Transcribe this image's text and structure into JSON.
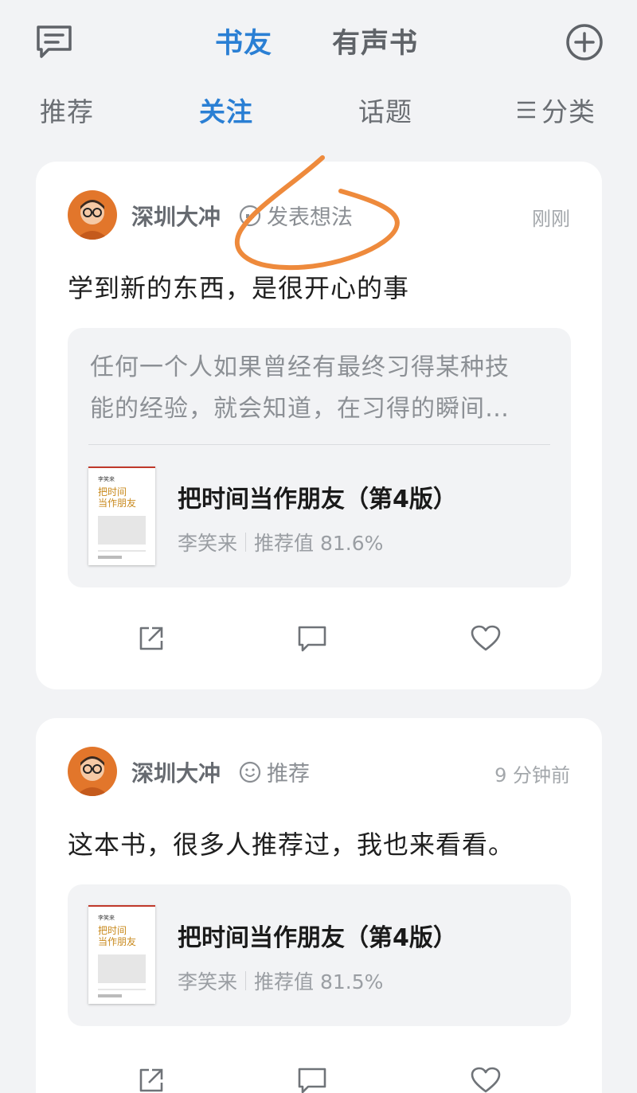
{
  "header": {
    "tabs": [
      {
        "label": "书友",
        "active": true
      },
      {
        "label": "有声书",
        "active": false
      }
    ],
    "icons": {
      "left": "message-icon",
      "right": "add-circle-icon"
    }
  },
  "subtabs": [
    {
      "label": "推荐",
      "active": false
    },
    {
      "label": "关注",
      "active": true
    },
    {
      "label": "话题",
      "active": false
    },
    {
      "label": "分类",
      "active": false,
      "icon": "menu-lines-icon"
    }
  ],
  "posts": [
    {
      "user": "深圳大冲",
      "action": "发表想法",
      "action_icon": "quote-icon",
      "time": "刚刚",
      "text": "学到新的东西，是很开心的事",
      "excerpt_lines": [
        "任何一个人如果曾经有最终习得某种技",
        "能的经验，就会知道，在习得的瞬间…"
      ],
      "book": {
        "title": "把时间当作朋友（第4版）",
        "author": "李笑来",
        "rating": "推荐值 81.6%"
      }
    },
    {
      "user": "深圳大冲",
      "action": "推荐",
      "action_icon": "smile-icon",
      "time": "9 分钟前",
      "text": "这本书，很多人推荐过，我也来看看。",
      "book": {
        "title": "把时间当作朋友（第4版）",
        "author": "李笑来",
        "rating": "推荐值 81.5%"
      }
    }
  ],
  "book_cover": {
    "author": "李笑来",
    "title_line1": "把时间",
    "title_line2": "当作朋友"
  },
  "colors": {
    "accent": "#2a7fd4",
    "background": "#f2f3f5",
    "annotation": "#ee8a3c",
    "avatar": "#e2762b"
  }
}
